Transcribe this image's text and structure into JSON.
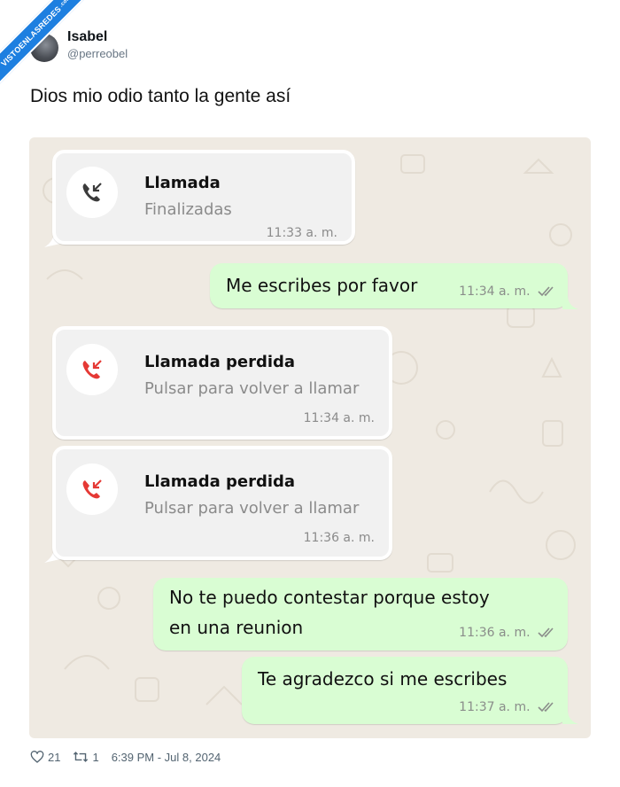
{
  "watermark": {
    "text": "VISTOENLASREDES",
    "suffix": ".com"
  },
  "author": {
    "name": "Isabel",
    "handle": "@perreobel"
  },
  "tweet": {
    "text": "Dios mio odio tanto la gente así"
  },
  "chat": {
    "messages": [
      {
        "type": "call",
        "title": "Llamada",
        "subtitle": "Finalizadas",
        "time": "11:33 a. m.",
        "icon": "outgoing-call-icon",
        "icon_color": "#3b3b3b"
      },
      {
        "type": "text",
        "text": "Me escribes por favor",
        "time": "11:34 a. m."
      },
      {
        "type": "call",
        "title": "Llamada perdida",
        "subtitle": "Pulsar para volver a llamar",
        "time": "11:34 a. m.",
        "icon": "missed-call-icon",
        "icon_color": "#e53935"
      },
      {
        "type": "call",
        "title": "Llamada perdida",
        "subtitle": "Pulsar para volver a llamar",
        "time": "11:36 a. m.",
        "icon": "missed-call-icon",
        "icon_color": "#e53935"
      },
      {
        "type": "text",
        "line1": "No te puedo contestar porque estoy",
        "line2": "en una reunion",
        "time": "11:36 a. m."
      },
      {
        "type": "text",
        "text": "Te agradezco si me escribes",
        "time": "11:37 a. m."
      }
    ],
    "colors": {
      "background": "#efeae2",
      "outgoing": "#d9fdd3",
      "call_bubble": "#f1f1f1",
      "missed": "#e53935"
    }
  },
  "footer": {
    "likes": "21",
    "retweets": "1",
    "timestamp": "6:39 PM - Jul 8, 2024"
  }
}
